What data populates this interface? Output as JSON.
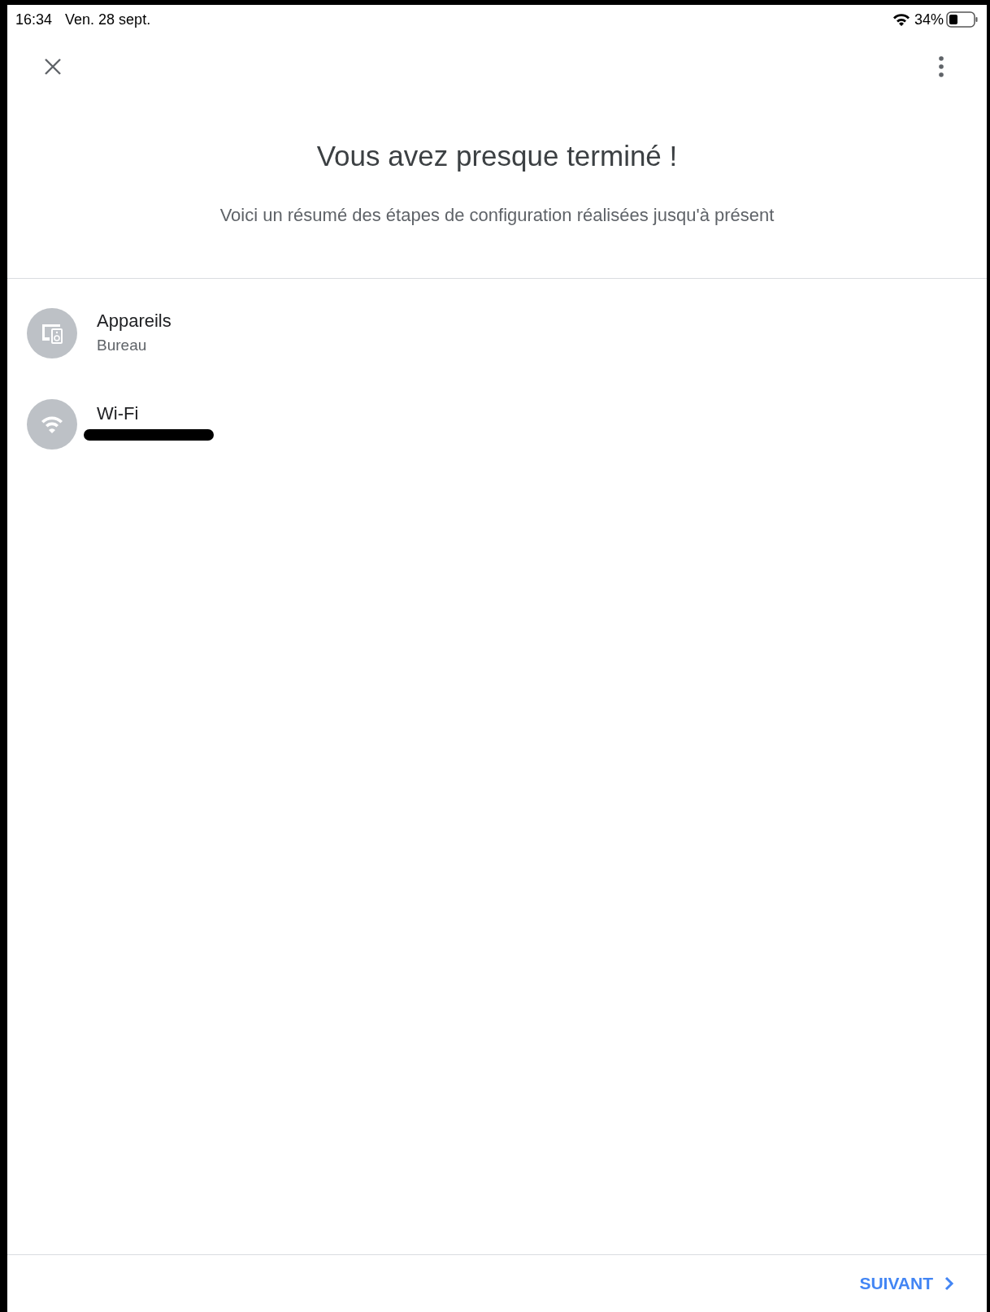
{
  "status_bar": {
    "time": "16:34",
    "date": "Ven. 28 sept.",
    "battery": "34%"
  },
  "title": "Vous avez presque terminé !",
  "subtitle": "Voici un résumé des étapes de configuration réalisées jusqu'à présent",
  "items": [
    {
      "kind": "devices",
      "title": "Appareils",
      "subtitle": "Bureau",
      "redacted": false
    },
    {
      "kind": "wifi",
      "title": "Wi-Fi",
      "redacted": true
    }
  ],
  "next_button": "SUIVANT"
}
